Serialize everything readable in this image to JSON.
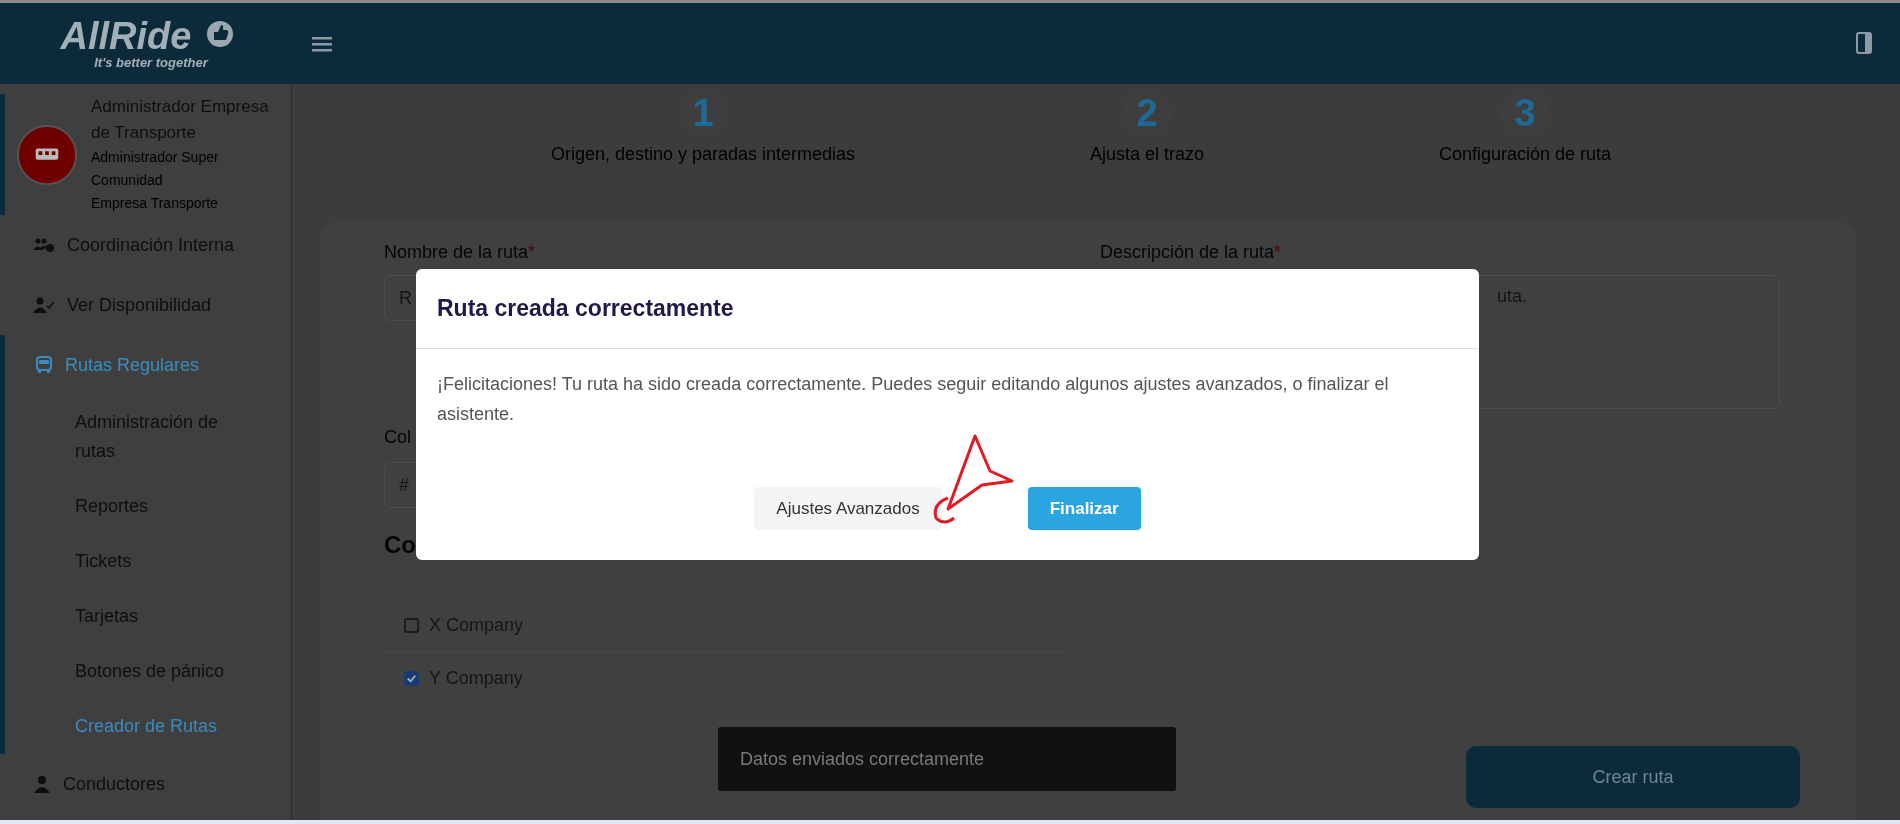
{
  "header": {
    "logo": "AllRide",
    "tagline": "It's better together"
  },
  "profile": {
    "name": "Administrador Empresa de Transporte",
    "roles": [
      "Administrador Super Comunidad",
      "Empresa Transporte"
    ]
  },
  "sidebar": {
    "items": [
      {
        "label": "Coordinación Interna",
        "selected": false,
        "expanded": false
      },
      {
        "label": "Ver Disponibilidad",
        "selected": false,
        "expanded": false
      },
      {
        "label": "Rutas Regulares",
        "selected": true,
        "expanded": true,
        "children": [
          {
            "label": "Administración de rutas",
            "selected": false
          },
          {
            "label": "Reportes",
            "selected": false
          },
          {
            "label": "Tickets",
            "selected": false
          },
          {
            "label": "Tarjetas",
            "selected": false
          },
          {
            "label": "Botones de pánico",
            "selected": false
          },
          {
            "label": "Creador de Rutas",
            "selected": true
          }
        ]
      },
      {
        "label": "Conductores",
        "selected": false,
        "expanded": false
      }
    ]
  },
  "steps": [
    {
      "number": "1",
      "label": "Origen, destino y paradas intermedias"
    },
    {
      "number": "2",
      "label": "Ajusta el trazo"
    },
    {
      "number": "3",
      "label": "Configuración de ruta"
    }
  ],
  "form": {
    "name_label": "Nombre de la ruta",
    "name_required_mark": "*",
    "name_value": "R",
    "description_label": "Descripción de la ruta",
    "description_required_mark": "*",
    "description_value": "uta.",
    "color_label": "Col",
    "color_value": "#",
    "companies_heading": "Co",
    "companies": [
      {
        "label": "X Company",
        "checked": false
      },
      {
        "label": "Y Company",
        "checked": true
      }
    ],
    "submit": "Crear ruta"
  },
  "modal": {
    "title": "Ruta creada correctamente",
    "message": "¡Felicitaciones! Tu ruta ha sido creada correctamente. Puedes seguir editando algunos ajustes avanzados, o finalizar el asistente.",
    "buttons": [
      {
        "label": "Ajustes Avanzados",
        "kind": "secondary"
      },
      {
        "label": "Finalizar",
        "kind": "primary"
      }
    ]
  },
  "toast": {
    "text": "Datos enviados correctamente"
  }
}
